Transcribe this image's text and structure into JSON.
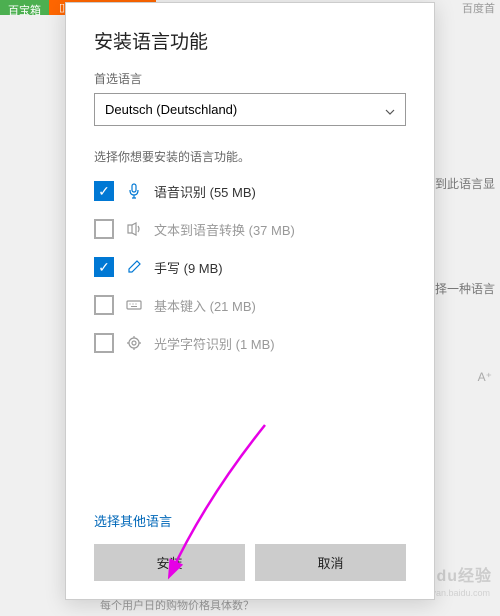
{
  "bg": {
    "tab_green": "百宝箱",
    "tab_orange": "新人答题领红包",
    "search": "百度首",
    "right1": "到此语言显",
    "right2": "择一种语言",
    "icon": "A⁺",
    "bottom": "每个用户日的购物价格具体数？"
  },
  "watermark": {
    "main": "Baidu经验",
    "sub": "jingyan.baidu.com"
  },
  "dialog": {
    "title": "安装语言功能",
    "preferred_label": "首选语言",
    "dropdown_value": "Deutsch (Deutschland)",
    "select_label": "选择你想要安装的语言功能。",
    "features": [
      {
        "label": "语音识别 (55 MB)",
        "checked": true,
        "enabled": true,
        "icon": "mic"
      },
      {
        "label": "文本到语音转换 (37 MB)",
        "checked": false,
        "enabled": false,
        "icon": "tts"
      },
      {
        "label": "手写 (9 MB)",
        "checked": true,
        "enabled": true,
        "icon": "pen"
      },
      {
        "label": "基本键入 (21 MB)",
        "checked": false,
        "enabled": false,
        "icon": "keyboard"
      },
      {
        "label": "光学字符识别 (1 MB)",
        "checked": false,
        "enabled": false,
        "icon": "ocr"
      }
    ],
    "other_lang": "选择其他语言",
    "install_btn": "安装",
    "cancel_btn": "取消"
  }
}
